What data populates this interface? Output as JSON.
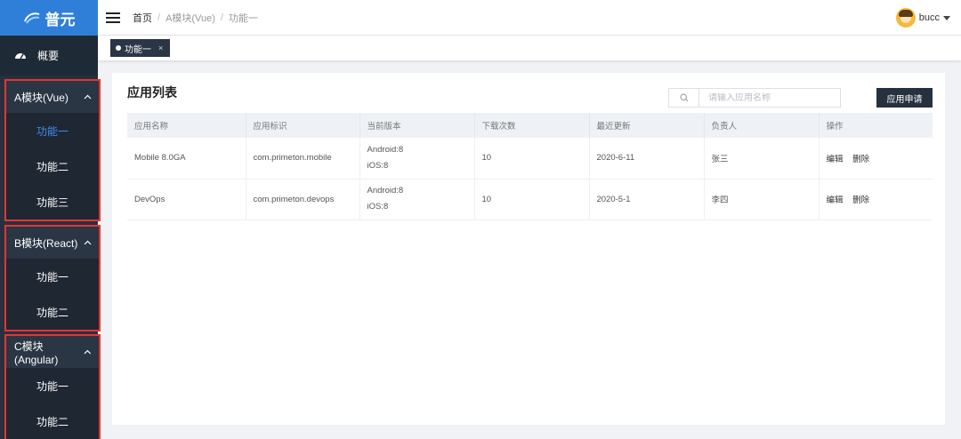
{
  "sidebar": {
    "logo_text": "普元",
    "overview": "概要",
    "groups": [
      {
        "title": "A模块(Vue)",
        "items": [
          "功能一",
          "功能二",
          "功能三"
        ]
      },
      {
        "title": "B模块(React)",
        "items": [
          "功能一",
          "功能二"
        ]
      },
      {
        "title": "C模块(Angular)",
        "items": [
          "功能一",
          "功能二"
        ]
      }
    ]
  },
  "header": {
    "breadcrumb": [
      "首页",
      "A模块(Vue)",
      "功能一"
    ],
    "sep": "/",
    "username": "bucc"
  },
  "tabs": [
    {
      "label": "功能一",
      "close": "×"
    }
  ],
  "main": {
    "title": "应用列表",
    "search_placeholder": "请输入应用名称",
    "apply_button": "应用申请",
    "table": {
      "columns": [
        "应用名称",
        "应用标识",
        "当前版本",
        "下载次数",
        "最近更新",
        "负责人",
        "操作"
      ],
      "rows": [
        {
          "name": "Mobile 8.0GA",
          "id": "com.primeton.mobile",
          "ver1": "Android:8",
          "ver2": "iOS:8",
          "downloads": "10",
          "updated": "2020-6-11",
          "owner": "张三",
          "edit": "编辑",
          "delete": "删除"
        },
        {
          "name": "DevOps",
          "id": "com.primeton.devops",
          "ver1": "Android:8",
          "ver2": "iOS:8",
          "downloads": "10",
          "updated": "2020-5-1",
          "owner": "李四",
          "edit": "编辑",
          "delete": "删除"
        }
      ]
    }
  },
  "colors": {
    "sidebar_bg": "#26313f",
    "logo_bg": "#2f7fd8",
    "active_text": "#3d8ef0",
    "highlight_border": "#e63434"
  }
}
